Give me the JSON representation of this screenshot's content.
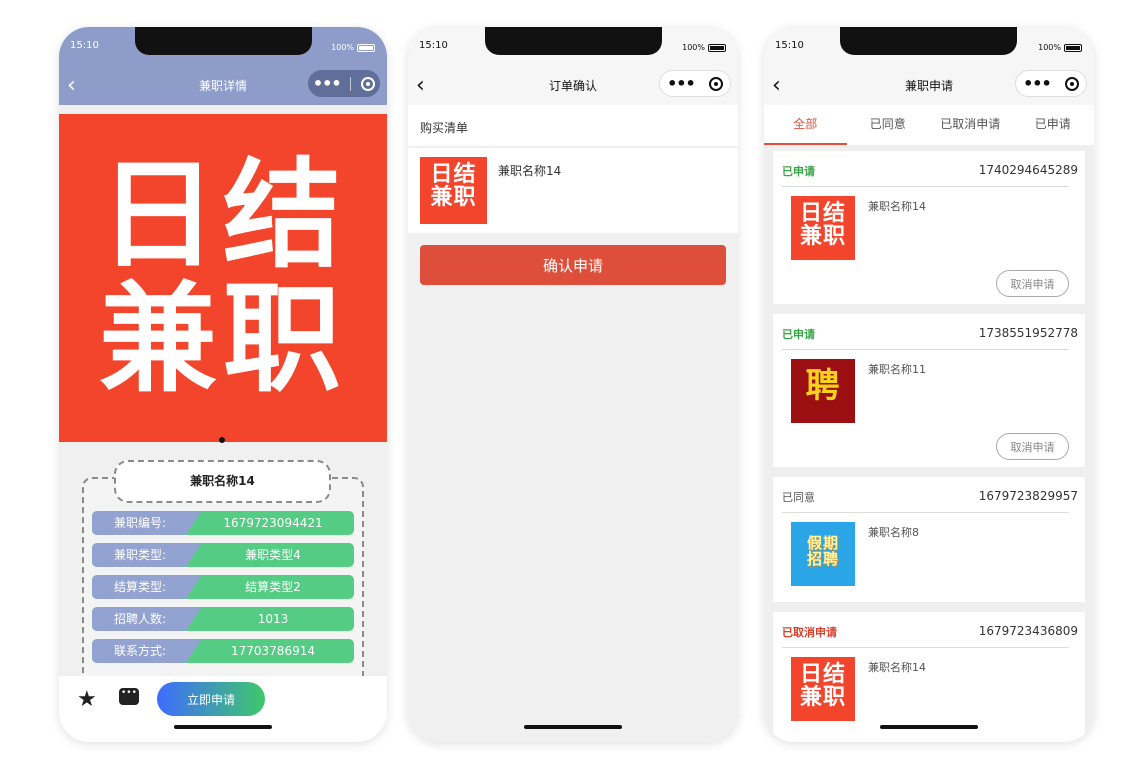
{
  "status": {
    "time": "15:10",
    "battery": "100%"
  },
  "phone1": {
    "title": "兼职详情",
    "banner_logo": [
      "日结",
      "兼职"
    ],
    "job_name": "兼职名称14",
    "rows": [
      {
        "label": "兼职编号:",
        "value": "1679723094421"
      },
      {
        "label": "兼职类型:",
        "value": "兼职类型4"
      },
      {
        "label": "结算类型:",
        "value": "结算类型2"
      },
      {
        "label": "招聘人数:",
        "value": "1013"
      },
      {
        "label": "联系方式:",
        "value": "17703786914"
      }
    ],
    "apply_label": "立即申请"
  },
  "phone2": {
    "title": "订单确认",
    "list_title": "购买清单",
    "item_name": "兼职名称14",
    "thumb_logo": [
      "日结",
      "兼职"
    ],
    "confirm_label": "确认申请"
  },
  "phone3": {
    "title": "兼职申请",
    "tabs": [
      "全部",
      "已同意",
      "已取消申请",
      "已申请"
    ],
    "cards": [
      {
        "status": "已申请",
        "status_color": "#3aa64a",
        "order_no": "1740294645289",
        "name": "兼职名称14",
        "thumb_logo": [
          "日结",
          "兼职"
        ],
        "action": "取消申请"
      },
      {
        "status": "已申请",
        "status_color": "#3aa64a",
        "order_no": "1738551952778",
        "name": "兼职名称11",
        "thumb_logo": [
          "聘"
        ],
        "action": "取消申请"
      },
      {
        "status": "已同意",
        "status_color": "#555555",
        "order_no": "1679723829957",
        "name": "兼职名称8",
        "thumb_logo": [
          "假期",
          "招聘"
        ]
      },
      {
        "status": "已取消申请",
        "status_color": "#d9412f",
        "order_no": "1679723436809",
        "name": "兼职名称14",
        "thumb_logo": [
          "日结",
          "兼职"
        ]
      }
    ]
  }
}
